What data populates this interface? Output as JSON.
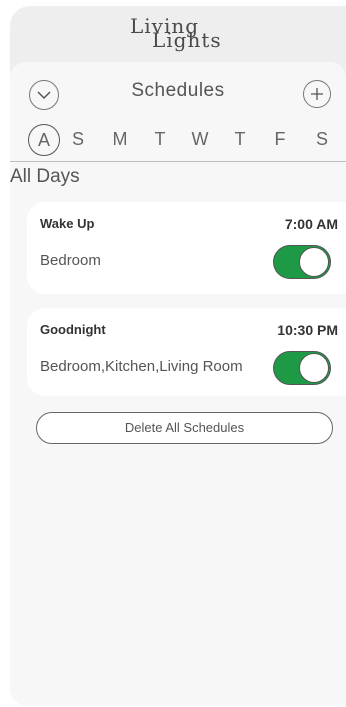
{
  "app": {
    "logo_line1": "Living",
    "logo_line2": "Lights"
  },
  "header": {
    "title": "Schedules",
    "collapse_icon": "chevron-down-icon",
    "add_icon": "plus-icon"
  },
  "days": [
    {
      "label": "A",
      "selected": true
    },
    {
      "label": "S"
    },
    {
      "label": "M"
    },
    {
      "label": "T"
    },
    {
      "label": "W"
    },
    {
      "label": "T"
    },
    {
      "label": "F"
    },
    {
      "label": "S"
    }
  ],
  "section_label": "All Days",
  "schedules": [
    {
      "name": "Wake Up",
      "time": "7:00 AM",
      "rooms": "Bedroom",
      "enabled": true
    },
    {
      "name": "Goodnight",
      "time": "10:30 PM",
      "rooms": "Bedroom,Kitchen,Living Room",
      "enabled": true
    }
  ],
  "actions": {
    "delete_all_label": "Delete All Schedules"
  },
  "colors": {
    "toggle_on": "#1e9a47",
    "background": "#eeeeee",
    "panel": "#f7f7f7"
  }
}
